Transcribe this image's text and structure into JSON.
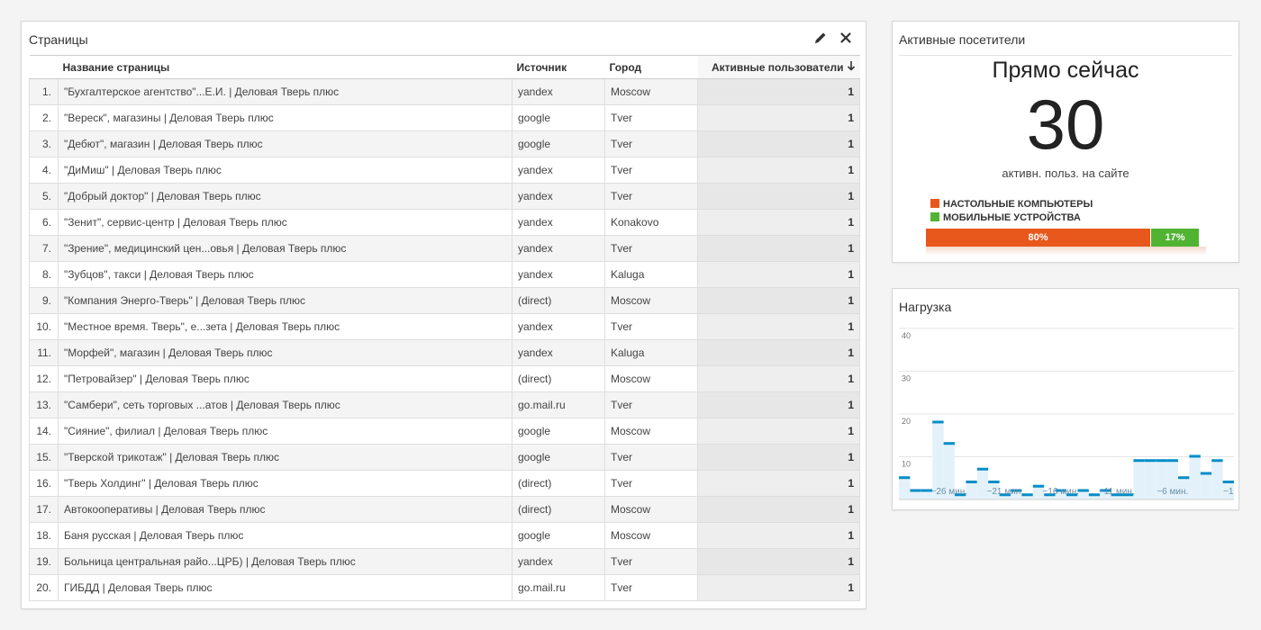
{
  "pages_panel": {
    "title": "Страницы",
    "columns": {
      "page": "Название страницы",
      "source": "Источник",
      "city": "Город",
      "users": "Активные пользователи"
    },
    "rows": [
      {
        "n": "1.",
        "page": "\"Бухгалтерское агентство\"...Е.И. | Деловая Тверь плюс",
        "source": "yandex",
        "city": "Moscow",
        "users": "1"
      },
      {
        "n": "2.",
        "page": "\"Вереск\", магазины | Деловая Тверь плюс",
        "source": "google",
        "city": "Tver",
        "users": "1"
      },
      {
        "n": "3.",
        "page": "\"Дебют\", магазин | Деловая Тверь плюс",
        "source": "google",
        "city": "Tver",
        "users": "1"
      },
      {
        "n": "4.",
        "page": "\"ДиМиш\" | Деловая Тверь плюс",
        "source": "yandex",
        "city": "Tver",
        "users": "1"
      },
      {
        "n": "5.",
        "page": "\"Добрый доктор\" | Деловая Тверь плюс",
        "source": "yandex",
        "city": "Tver",
        "users": "1"
      },
      {
        "n": "6.",
        "page": "\"Зенит\", сервис-центр | Деловая Тверь плюс",
        "source": "yandex",
        "city": "Konakovo",
        "users": "1"
      },
      {
        "n": "7.",
        "page": "\"Зрение\", медицинский цен...овья | Деловая Тверь плюс",
        "source": "yandex",
        "city": "Tver",
        "users": "1"
      },
      {
        "n": "8.",
        "page": "\"Зубцов\", такси | Деловая Тверь плюс",
        "source": "yandex",
        "city": "Kaluga",
        "users": "1"
      },
      {
        "n": "9.",
        "page": "\"Компания Энерго-Тверь\" | Деловая Тверь плюс",
        "source": "(direct)",
        "city": "Moscow",
        "users": "1"
      },
      {
        "n": "10.",
        "page": "\"Местное время. Тверь\", е...зета | Деловая Тверь плюс",
        "source": "yandex",
        "city": "Tver",
        "users": "1"
      },
      {
        "n": "11.",
        "page": "\"Морфей\", магазин | Деловая Тверь плюс",
        "source": "yandex",
        "city": "Kaluga",
        "users": "1"
      },
      {
        "n": "12.",
        "page": "\"Петровайзер\" | Деловая Тверь плюс",
        "source": "(direct)",
        "city": "Moscow",
        "users": "1"
      },
      {
        "n": "13.",
        "page": "\"Самбери\", сеть торговых ...атов | Деловая Тверь плюс",
        "source": "go.mail.ru",
        "city": "Tver",
        "users": "1"
      },
      {
        "n": "14.",
        "page": "\"Сияние\", филиал | Деловая Тверь плюс",
        "source": "google",
        "city": "Moscow",
        "users": "1"
      },
      {
        "n": "15.",
        "page": "\"Тверской трикотаж\" | Деловая Тверь плюс",
        "source": "google",
        "city": "Tver",
        "users": "1"
      },
      {
        "n": "16.",
        "page": "\"Тверь Холдинг\" | Деловая Тверь плюс",
        "source": "(direct)",
        "city": "Tver",
        "users": "1"
      },
      {
        "n": "17.",
        "page": "Автокооперативы | Деловая Тверь плюс",
        "source": "(direct)",
        "city": "Moscow",
        "users": "1"
      },
      {
        "n": "18.",
        "page": "Баня русская | Деловая Тверь плюс",
        "source": "google",
        "city": "Moscow",
        "users": "1"
      },
      {
        "n": "19.",
        "page": "Больница центральная райо...ЦРБ) | Деловая Тверь плюс",
        "source": "yandex",
        "city": "Tver",
        "users": "1"
      },
      {
        "n": "20.",
        "page": "ГИБДД | Деловая Тверь плюс",
        "source": "go.mail.ru",
        "city": "Tver",
        "users": "1"
      }
    ]
  },
  "active_panel": {
    "title": "Активные посетители",
    "now_label": "Прямо сейчас",
    "count": "30",
    "subtitle": "активн. польз. на сайте",
    "legend": [
      {
        "label": "НАСТОЛЬНЫЕ КОМПЬЮТЕРЫ",
        "color": "#e8581c"
      },
      {
        "label": "МОБИЛЬНЫЕ УСТРОЙСТВА",
        "color": "#50b432"
      }
    ],
    "bar": [
      {
        "label": "80%",
        "percent": 80,
        "color": "#e8581c"
      },
      {
        "label": "17%",
        "percent": 17,
        "color": "#50b432"
      }
    ]
  },
  "load_panel": {
    "title": "Нагрузка",
    "chart_data": {
      "type": "area",
      "ylim": [
        0,
        40
      ],
      "yticks": [
        "10",
        "20",
        "30",
        "40"
      ],
      "xtick_labels": [
        "−26 мин.",
        "−21 мин.",
        "−16 мин.",
        "−11 мин.",
        "−6 мин.",
        "−1"
      ],
      "x": [
        -30,
        -29,
        -28,
        -27,
        -26,
        -25,
        -24,
        -23,
        -22,
        -21,
        -20,
        -19,
        -18,
        -17,
        -16,
        -15,
        -14,
        -13,
        -12,
        -11,
        -10,
        -9,
        -8,
        -7,
        -6,
        -5,
        -4,
        -3,
        -2,
        -1
      ],
      "values": [
        5,
        2,
        2,
        18,
        13,
        1,
        4,
        7,
        4,
        1,
        2,
        1,
        3,
        1,
        2,
        1,
        2,
        1,
        2,
        1,
        1,
        9,
        9,
        9,
        9,
        5,
        10,
        6,
        9,
        4
      ],
      "colors": {
        "line": "#058dc7",
        "fill": "#e3f2fa"
      }
    }
  }
}
